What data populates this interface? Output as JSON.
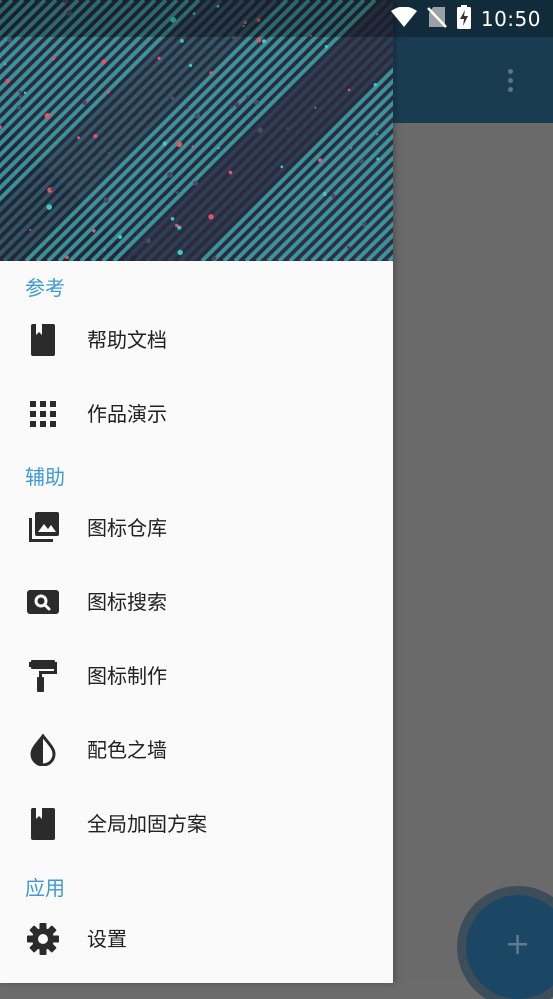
{
  "status_bar": {
    "time": "10:50",
    "icons": [
      "wifi-icon",
      "no-sim-icon",
      "battery-charging-icon"
    ]
  },
  "app_bar": {
    "overflow_icon": "more-vert-icon"
  },
  "drawer": {
    "sections": [
      {
        "label": "参考",
        "items": [
          {
            "label": "帮助文档",
            "icon": "book-icon"
          },
          {
            "label": "作品演示",
            "icon": "grid-icon"
          }
        ]
      },
      {
        "label": "辅助",
        "items": [
          {
            "label": "图标仓库",
            "icon": "photo-library-icon"
          },
          {
            "label": "图标搜索",
            "icon": "image-search-icon"
          },
          {
            "label": "图标制作",
            "icon": "paint-roller-icon"
          },
          {
            "label": "配色之墙",
            "icon": "contrast-drop-icon"
          },
          {
            "label": "全局加固方案",
            "icon": "book-icon"
          }
        ]
      },
      {
        "label": "应用",
        "items": [
          {
            "label": "设置",
            "icon": "settings-gear-icon"
          }
        ]
      }
    ]
  },
  "fab": {
    "icon": "plus-icon",
    "symbol": "+"
  },
  "colors": {
    "accent": "#3d9ad6",
    "app_bar": "#1a3c52",
    "drawer_bg": "#fafafa",
    "header_bg": "#2b2a40",
    "header_stripes": "#3fc7c2"
  }
}
